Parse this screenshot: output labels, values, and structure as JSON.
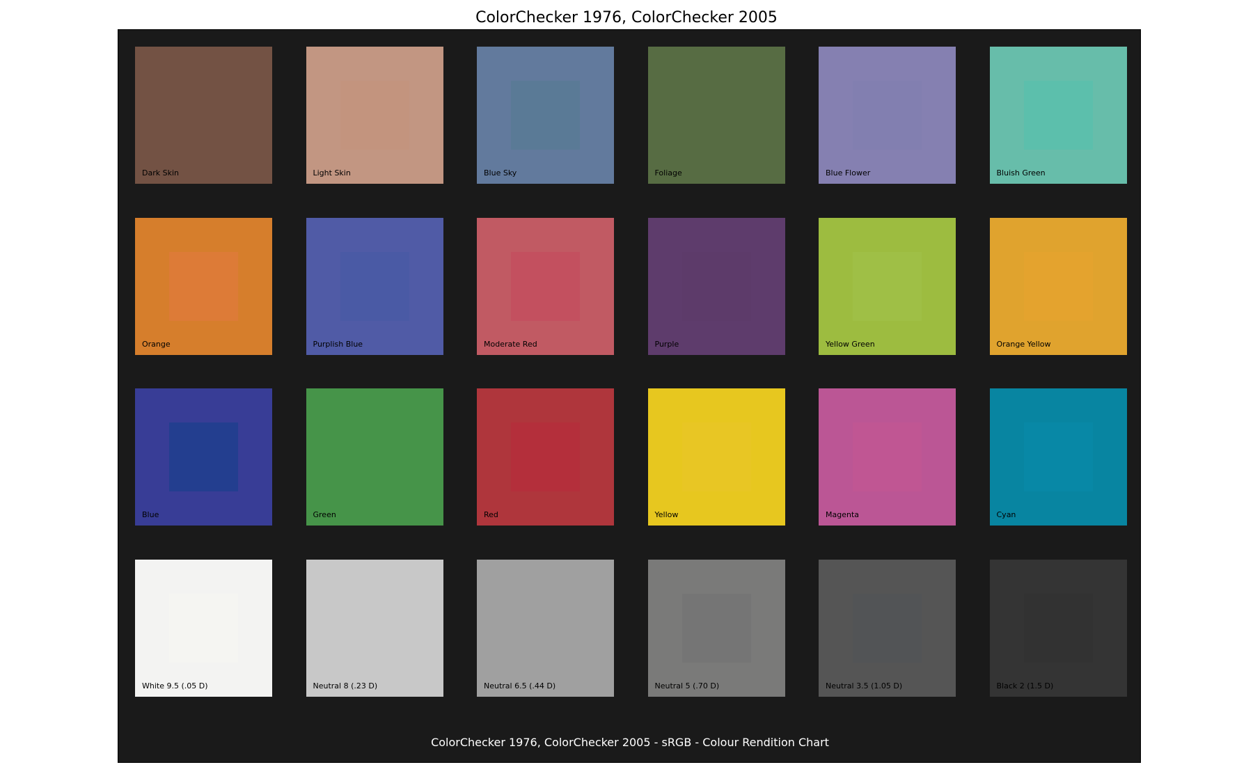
{
  "chart_data": {
    "type": "table",
    "title": "ColorChecker 1976, ColorChecker 2005",
    "caption": "ColorChecker 1976, ColorChecker 2005 - sRGB - Colour Rendition Chart",
    "grid": {
      "rows": 4,
      "columns": 6
    },
    "background_color": "#1a1a1a",
    "swatches": [
      {
        "label": "Dark Skin",
        "outer": "#735244",
        "inner": "#735244"
      },
      {
        "label": "Light Skin",
        "outer": "#c29682",
        "inner": "#c3947e"
      },
      {
        "label": "Blue Sky",
        "outer": "#627a9d",
        "inner": "#5a7a96"
      },
      {
        "label": "Foliage",
        "outer": "#576c43",
        "inner": "#576c43"
      },
      {
        "label": "Blue Flower",
        "outer": "#8580b1",
        "inner": "#827fb0"
      },
      {
        "label": "Bluish Green",
        "outer": "#67bdaa",
        "inner": "#5cbfac"
      },
      {
        "label": "Orange",
        "outer": "#d67e2c",
        "inner": "#dd7b37"
      },
      {
        "label": "Purplish Blue",
        "outer": "#505ba6",
        "inner": "#4a5aa5"
      },
      {
        "label": "Moderate Red",
        "outer": "#c15a63",
        "inner": "#c3505f"
      },
      {
        "label": "Purple",
        "outer": "#5e3c6c",
        "inner": "#5d3b6a"
      },
      {
        "label": "Yellow Green",
        "outer": "#9dbc40",
        "inner": "#9fbf46"
      },
      {
        "label": "Orange Yellow",
        "outer": "#e0a32e",
        "inner": "#e4a32e"
      },
      {
        "label": "Blue",
        "outer": "#383d96",
        "inner": "#233e8f"
      },
      {
        "label": "Green",
        "outer": "#469449",
        "inner": "#469449"
      },
      {
        "label": "Red",
        "outer": "#af363c",
        "inner": "#b42f3b"
      },
      {
        "label": "Yellow",
        "outer": "#e7c71f",
        "inner": "#e8c624"
      },
      {
        "label": "Magenta",
        "outer": "#bb5695",
        "inner": "#c05693"
      },
      {
        "label": "Cyan",
        "outer": "#0885a1",
        "inner": "#0888a6"
      },
      {
        "label": "White 9.5 (.05 D)",
        "outer": "#f3f3f2",
        "inner": "#f5f5f2"
      },
      {
        "label": "Neutral 8 (.23 D)",
        "outer": "#c8c8c8",
        "inner": "#c8c8c8"
      },
      {
        "label": "Neutral 6.5 (.44 D)",
        "outer": "#a0a0a0",
        "inner": "#a0a0a0"
      },
      {
        "label": "Neutral 5 (.70 D)",
        "outer": "#7a7a79",
        "inner": "#757575"
      },
      {
        "label": "Neutral 3.5 (1.05 D)",
        "outer": "#555555",
        "inner": "#525456"
      },
      {
        "label": "Black 2 (1.5 D)",
        "outer": "#343434",
        "inner": "#323232"
      }
    ]
  }
}
